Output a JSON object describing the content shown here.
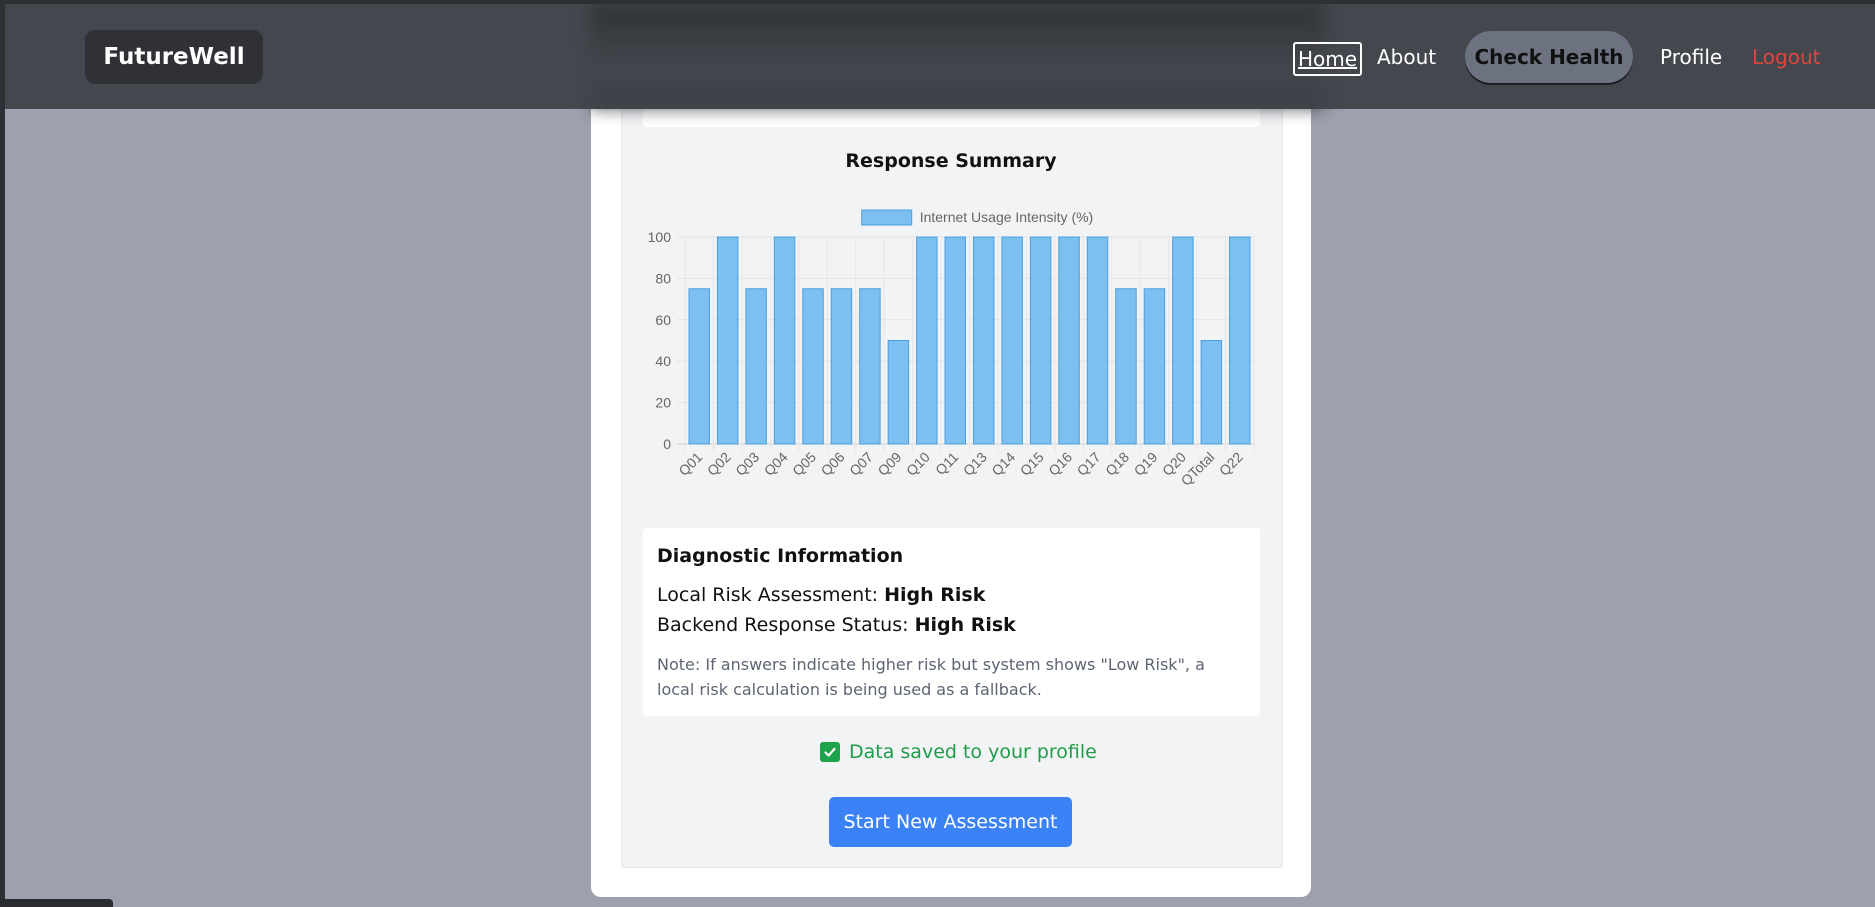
{
  "nav": {
    "brand": "FutureWell",
    "home": "Home",
    "about": "About",
    "check_health": "Check Health",
    "profile": "Profile",
    "logout": "Logout",
    "logout_color": "#e0443e"
  },
  "summary": {
    "title": "Response Summary"
  },
  "chart_data": {
    "type": "bar",
    "legend": "Internet Usage Intensity (%)",
    "categories": [
      "Q01",
      "Q02",
      "Q03",
      "Q04",
      "Q05",
      "Q06",
      "Q07",
      "Q09",
      "Q10",
      "Q11",
      "Q13",
      "Q14",
      "Q15",
      "Q16",
      "Q17",
      "Q18",
      "Q19",
      "Q20",
      "QTotal",
      "Q22"
    ],
    "series": [
      {
        "name": "Internet Usage Intensity (%)",
        "values": [
          75,
          100,
          75,
          100,
          75,
          75,
          75,
          50,
          100,
          100,
          100,
          100,
          100,
          100,
          100,
          75,
          75,
          100,
          50,
          100
        ]
      }
    ],
    "ylim": [
      0,
      100
    ],
    "yticks": [
      0,
      20,
      40,
      60,
      80,
      100
    ],
    "grid": true,
    "legend_position": "top",
    "bar_color": "#7cbff0",
    "bar_border": "#4a9fe0"
  },
  "diagnostic": {
    "title": "Diagnostic Information",
    "local_label": "Local Risk Assessment: ",
    "local_value": "High Risk",
    "backend_label": "Backend Response Status: ",
    "backend_value": "High Risk",
    "note": "Note: If answers indicate higher risk but system shows \"Low Risk\", a local risk calculation is being used as a fallback."
  },
  "saved": {
    "text": "Data saved to your profile",
    "checked": true
  },
  "actions": {
    "start_new": "Start New Assessment"
  }
}
